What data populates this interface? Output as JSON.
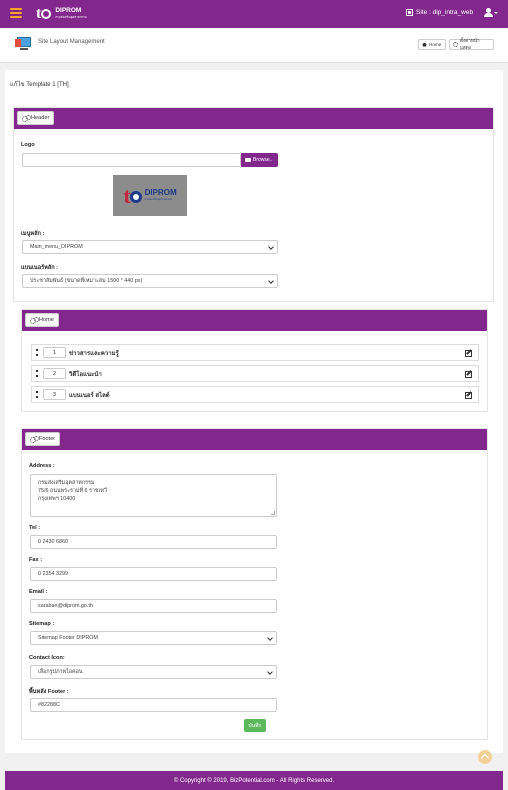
{
  "topbar": {
    "brand_text": "DIPROM",
    "brand_subtext": "กรมส่งเสริมอุตสาหกรรม",
    "site_label": "Site : dip_intra_web"
  },
  "page_header": {
    "title": "Site Layout Management",
    "home_label": "Home",
    "settings_label": "ตั้งค่าหน้าแสดง"
  },
  "template_label": "แก้ไข Template 1 [TH]",
  "header_section": {
    "button_label": "Header",
    "logo_label": "Logo",
    "logo_input_value": "",
    "browse_label": "Browse..",
    "logo_preview_text": "DIPROM",
    "logo_preview_subtext": "กรมส่งเสริมอุตสาหกรรม",
    "main_menu_label": "เมนูหลัก :",
    "main_menu_value": "Main_menu_DIPROM",
    "main_banner_label": "แบนเนอร์หลัก :",
    "main_banner_value": "ประชาสัมพันธ์ (ขนาดที่เหมาะสม 1500 * 440 px)"
  },
  "home_section": {
    "button_label": "Home",
    "rows": [
      {
        "order": "1",
        "label": "ข่าวสารและความรู้"
      },
      {
        "order": "2",
        "label": "วิดีโอแนะนำ"
      },
      {
        "order": "3",
        "label": "แบนเนอร์ สไลด์"
      }
    ]
  },
  "footer_section": {
    "button_label": "Footer",
    "address_label": "Address :",
    "address_lines": [
      "กรมส่งเสริมอุตสาหกรรม",
      "75/6 ถนนพระรามที่ 6 ราชเทวี",
      "กรุงเทพฯ 10400"
    ],
    "tel_label": "Tel :",
    "tel_value": "0 2430 6860",
    "fax_label": "Fax :",
    "fax_value": "0 2354 3299",
    "email_label": "Email :",
    "email_value": "saraban@diprom.go.th",
    "sitemap_label": "Sitemap :",
    "sitemap_value": "Sitemap Footer DIPROM",
    "contact_icon_label": "Contact Icon:",
    "contact_icon_value": "เลือกรูปภาพไอคอน",
    "bg_label": "พื้นหลัง Footer :",
    "bg_value": "#82288C",
    "save_label": "บันทึก"
  },
  "footer": {
    "copyright": "© Copyright © 2019, BizPotential.com - All Rights Reserved."
  },
  "colors": {
    "brand_purple": "#82288c",
    "save_green": "#5cb85c",
    "accent_orange": "#f5a623"
  },
  "icons": [
    "hamburger-icon",
    "site-icon",
    "user-icon",
    "home-icon",
    "gear-icon",
    "cogs-icon",
    "folder-icon",
    "drag-handle-icon",
    "edit-icon",
    "chevron-up-icon"
  ]
}
